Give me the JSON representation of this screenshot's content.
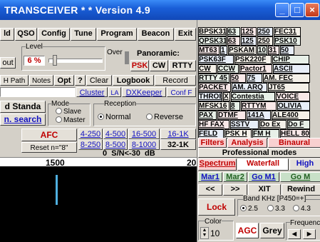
{
  "title": "TRANSCEIVER * *    Version 4.9",
  "window": {
    "minimize": "_",
    "maximize": "□",
    "close": "×"
  },
  "toolbar": [
    "ld",
    "QSO",
    "Config",
    "Tune",
    "Program",
    "Beacon",
    "Exit"
  ],
  "level": {
    "label": "Level",
    "value": "6 %",
    "out": "out"
  },
  "over": {
    "label": "Over"
  },
  "panoramic": {
    "label": "Panoramic:",
    "buttons": [
      "PSK",
      "CW",
      "RTTY"
    ]
  },
  "row3": [
    "H Path",
    "Notes",
    "Opt",
    "?",
    "Clear",
    "Logbook",
    "Record"
  ],
  "row4": [
    "Cluster",
    "LA",
    "DXKeeper",
    "Conf F"
  ],
  "standard": {
    "label": "d Standa",
    "search": "n. search"
  },
  "mode_group": {
    "label": "Mode",
    "options": [
      "Slave",
      "Master"
    ]
  },
  "reception": {
    "label": "Reception",
    "options": [
      "Normal",
      "Reverse"
    ]
  },
  "afc": {
    "label": "AFC",
    "reset": "Reset n=\"8\""
  },
  "filters": [
    [
      "4-250",
      "4-500",
      "16-500",
      "16-1K"
    ],
    [
      "8-250",
      "8-500",
      "8-1000",
      "32-1K"
    ]
  ],
  "sn_readout": "0  S/N<-30  dB",
  "scale": {
    "left": "1500",
    "right": "20"
  },
  "modes": [
    [
      "BPSK31",
      "63",
      "125",
      "250",
      "FEC31"
    ],
    [
      "QPSK31",
      "63",
      "125",
      "250",
      "PSK10"
    ],
    [
      "MT63",
      "1",
      "PSKAM",
      "10",
      "31",
      "50"
    ],
    [
      "PSK63F",
      "PSK220F",
      "CHIP"
    ],
    [
      "CW",
      "CCW",
      "Pactor1",
      "ASCII"
    ],
    [
      "RTTY 45",
      "50",
      "75",
      "AM. FEC"
    ],
    [
      "PACKET",
      "AM. ARQ",
      "JT65"
    ],
    [
      "THROB",
      "X",
      "Contestia",
      "VOICE"
    ],
    [
      "MFSK16",
      "8",
      "RTTYM",
      "OLIVIA"
    ],
    [
      "PAX",
      "DTMF",
      "141A",
      "ALE400"
    ],
    [
      "HF FAX",
      "SSTV",
      "Do Ex",
      "Do F"
    ],
    [
      "FELD",
      "PSK H",
      "FM H",
      "HELL 80"
    ]
  ],
  "filters_row": [
    "Filters",
    "Analysis",
    "Binaural"
  ],
  "pro_modes": "Professional modes",
  "spectrum_tabs": [
    "Spectrum",
    "Waterfall",
    "High"
  ],
  "markers": [
    "Mar1",
    "Mar2",
    "Go M1",
    "Go M"
  ],
  "nav": [
    "<<",
    ">>",
    "XIT",
    "Rewind"
  ],
  "lock": "Lock",
  "band": {
    "label": "Band KHz [P450=+]",
    "options": [
      "2.5",
      "3.3",
      "4.3"
    ]
  },
  "color": {
    "label": "Color",
    "value": "10"
  },
  "agc": "AGC",
  "grey": "Grey",
  "freq": {
    "label": "Frequenc"
  },
  "colors": {
    "accent_red": "#cc0000",
    "title_blue": "#1a5fd8",
    "waterfall_bg": "#000000",
    "signal": "#4fb0e0"
  }
}
